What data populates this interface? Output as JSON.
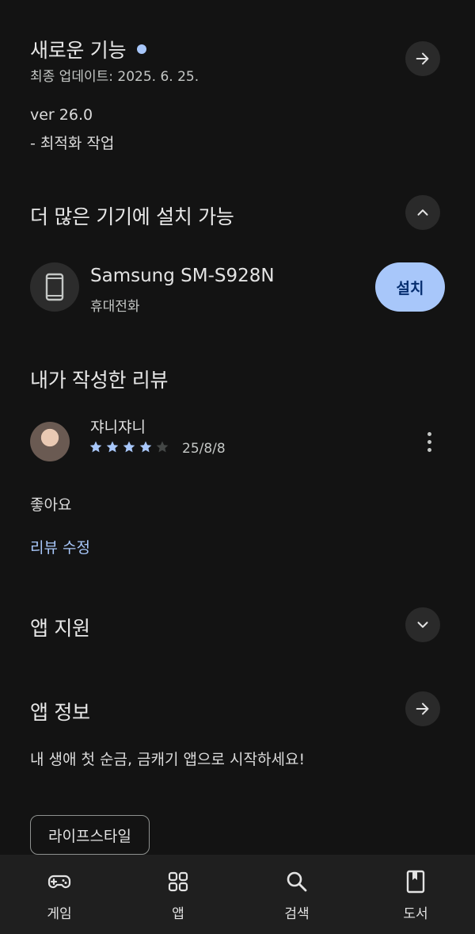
{
  "whats_new": {
    "title": "새로운 기능",
    "updated": "최종 업데이트: 2025. 6. 25.",
    "version": "ver 26.0",
    "notes": "- 최적화 작업"
  },
  "install_more": {
    "title": "더 많은 기기에 설치 가능",
    "device_name": "Samsung SM-S928N",
    "device_type": "휴대전화",
    "install_label": "설치"
  },
  "my_review": {
    "title": "내가 작성한 리뷰",
    "reviewer": "쟈니쟈니",
    "rating": 4,
    "max_rating": 5,
    "date": "25/8/8",
    "text": "좋아요",
    "edit_label": "리뷰 수정"
  },
  "app_support": {
    "title": "앱 지원"
  },
  "app_info": {
    "title": "앱 정보",
    "description": "내 생애 첫 순금, 금캐기 앱으로 시작하세요!",
    "category_chip": "라이프스타일"
  },
  "nav": {
    "items": [
      {
        "label": "게임",
        "icon": "gamepad-icon"
      },
      {
        "label": "앱",
        "icon": "apps-grid-icon"
      },
      {
        "label": "검색",
        "icon": "search-icon"
      },
      {
        "label": "도서",
        "icon": "book-icon"
      }
    ]
  },
  "colors": {
    "background": "#131313",
    "accent": "#a8c7fa",
    "star_filled": "#a8c7fa",
    "star_empty": "#444746"
  }
}
